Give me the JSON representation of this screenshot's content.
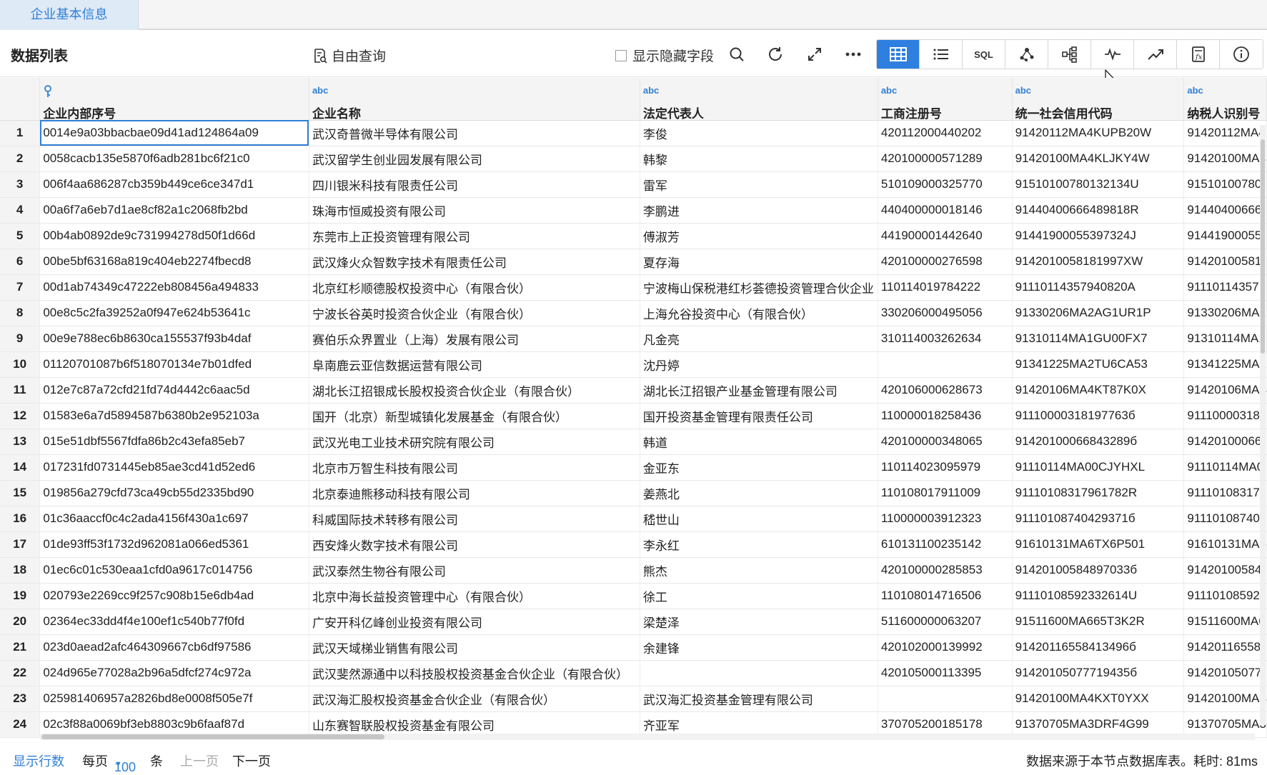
{
  "tabs": [
    {
      "label": "企业基本信息",
      "active": true
    }
  ],
  "toolbar": {
    "title": "数据列表",
    "free_query_label": "自由查询",
    "show_hidden_label": "显示隐藏字段",
    "sql_label": "SQL"
  },
  "columns": [
    {
      "type": "key",
      "label": "企业内部序号"
    },
    {
      "type": "abc",
      "label": "企业名称"
    },
    {
      "type": "abc",
      "label": "法定代表人"
    },
    {
      "type": "abc",
      "label": "工商注册号"
    },
    {
      "type": "abc",
      "label": "统一社会信用代码"
    },
    {
      "type": "abc",
      "label": "纳税人识别号"
    }
  ],
  "rows": [
    {
      "n": "1",
      "id": "0014e9a03bbacbae09d41ad124864a09",
      "name": "武汉奇普微半导体有限公司",
      "rep": "李俊",
      "reg": "420112000440202",
      "credit": "91420112MA4KUPB20W",
      "tax": "91420112MA4"
    },
    {
      "n": "2",
      "id": "0058cacb135e5870f6adb281bc6f21c0",
      "name": "武汉留学生创业园发展有限公司",
      "rep": "韩黎",
      "reg": "420100000571289",
      "credit": "91420100MA4KLJKY4W",
      "tax": "91420100MA4"
    },
    {
      "n": "3",
      "id": "006f4aa686287cb359b449ce6ce347d1",
      "name": "四川银米科技有限责任公司",
      "rep": "雷军",
      "reg": "510109000325770",
      "credit": "91510100780132134U",
      "tax": "91510100780"
    },
    {
      "n": "4",
      "id": "00a6f7a6eb7d1ae8cf82a1c2068fb2bd",
      "name": "珠海市恒威投资有限公司",
      "rep": "李鹏进",
      "reg": "440400000018146",
      "credit": "91440400666489818R",
      "tax": "91440400666"
    },
    {
      "n": "5",
      "id": "00b4ab0892de9c731994278d50f1d66d",
      "name": "东莞市上正投资管理有限公司",
      "rep": "傅淑芳",
      "reg": "441900001442640",
      "credit": "91441900055397324J",
      "tax": "91441900055"
    },
    {
      "n": "6",
      "id": "00be5bf63168a819c404eb2274fbecd8",
      "name": "武汉烽火众智数字技术有限责任公司",
      "rep": "夏存海",
      "reg": "420100000276598",
      "credit": "9142010058181997XW",
      "tax": "91420100581"
    },
    {
      "n": "7",
      "id": "00d1ab74349c47222eb808456a494833",
      "name": "北京红杉顺德股权投资中心（有限合伙）",
      "rep": "宁波梅山保税港红杉荟德投资管理合伙企业",
      "reg": "110114019784222",
      "credit": "91110114357940820A",
      "tax": "91110114357"
    },
    {
      "n": "8",
      "id": "00e8c5c2fa39252a0f947e624b53641c",
      "name": "宁波长谷英时投资合伙企业（有限合伙）",
      "rep": "上海允谷投资中心（有限合伙）",
      "reg": "330206000495056",
      "credit": "91330206MA2AG1UR1P",
      "tax": "91330206MA2"
    },
    {
      "n": "9",
      "id": "00e9e788ec6b8630ca155537f93b4daf",
      "name": "赛伯乐众界置业（上海）发展有限公司",
      "rep": "凡金亮",
      "reg": "310114003262634",
      "credit": "91310114MA1GU00FX7",
      "tax": "91310114MA1"
    },
    {
      "n": "10",
      "id": "01120701087b6f518070134e7b01dfed",
      "name": "阜南鹿云亚信数据运营有限公司",
      "rep": "沈丹婷",
      "reg": "",
      "credit": "91341225MA2TU6CA53",
      "tax": "91341225MA2"
    },
    {
      "n": "11",
      "id": "012e7c87a72cfd21fd74d4442c6aac5d",
      "name": "湖北长江招银成长股权投资合伙企业（有限合伙）",
      "rep": "湖北长江招银产业基金管理有限公司",
      "reg": "420106000628673",
      "credit": "91420106MA4KT87K0X",
      "tax": "91420106MA4"
    },
    {
      "n": "12",
      "id": "01583e6a7d5894587b6380b2e952103a",
      "name": "国开（北京）新型城镇化发展基金（有限合伙）",
      "rep": "国开投资基金管理有限责任公司",
      "reg": "110000018258436",
      "credit": "91110000318197763б",
      "tax": "91110000318"
    },
    {
      "n": "13",
      "id": "015e51dbf5567fdfa86b2c43efa85eb7",
      "name": "武汉光电工业技术研究院有限公司",
      "rep": "韩道",
      "reg": "420100000348065",
      "credit": "91420100066843289б",
      "tax": "91420100066"
    },
    {
      "n": "14",
      "id": "017231fd0731445eb85ae3cd41d52ed6",
      "name": "北京市万智生科技有限公司",
      "rep": "金亚东",
      "reg": "110114023095979",
      "credit": "91110114MA00CJYHXL",
      "tax": "91110114MA0"
    },
    {
      "n": "15",
      "id": "019856a279cfd73ca49cb55d2335bd90",
      "name": "北京泰迪熊移动科技有限公司",
      "rep": "姜燕北",
      "reg": "110108017911009",
      "credit": "91110108317961782R",
      "tax": "91110108317"
    },
    {
      "n": "16",
      "id": "01c36aaccf0c4c2ada4156f430a1c697",
      "name": "科威国际技术转移有限公司",
      "rep": "嵇世山",
      "reg": "110000003912323",
      "credit": "91110108740429371б",
      "tax": "91110108740"
    },
    {
      "n": "17",
      "id": "01de93ff53f1732d962081a066ed5361",
      "name": "西安烽火数字技术有限公司",
      "rep": "李永红",
      "reg": "610131100235142",
      "credit": "91610131MA6TX6P501",
      "tax": "91610131MA6"
    },
    {
      "n": "18",
      "id": "01ec6c01c530eaa1cfd0a9617c014756",
      "name": "武汉泰然生物谷有限公司",
      "rep": "熊杰",
      "reg": "420100000285853",
      "credit": "91420100584897033б",
      "tax": "91420100584"
    },
    {
      "n": "19",
      "id": "020793e2269cc9f257c908b15e6db4ad",
      "name": "北京中海长益投资管理中心（有限合伙）",
      "rep": "徐工",
      "reg": "110108014716506",
      "credit": "91110108592332614U",
      "tax": "91110108592"
    },
    {
      "n": "20",
      "id": "02364ec33dd4f4e100ef1c540b77f0fd",
      "name": "广安开科亿峰创业投资有限公司",
      "rep": "梁楚泽",
      "reg": "511600000063207",
      "credit": "91511600MA665T3K2R",
      "tax": "91511600MA6"
    },
    {
      "n": "21",
      "id": "023d0aead2afc464309667cb6df97586",
      "name": "武汉天域梯业销售有限公司",
      "rep": "余建锋",
      "reg": "420102000139992",
      "credit": "91420116558413496б",
      "tax": "91420116558"
    },
    {
      "n": "22",
      "id": "024d965e77028a2b96a5dfcf274c972a",
      "name": "武汉斐然源通中以科技股权投资基金合伙企业（有限合伙）",
      "rep": "",
      "reg": "420105000113395",
      "credit": "91420105077719435б",
      "tax": "91420105077"
    },
    {
      "n": "23",
      "id": "025981406957a2826bd8e0008f505e7f",
      "name": "武汉海汇股权投资基金合伙企业（有限合伙）",
      "rep": "武汉海汇投资基金管理有限公司",
      "reg": "",
      "credit": "91420100MA4KXT0YXX",
      "tax": "91420100MA4"
    },
    {
      "n": "24",
      "id": "02c3f88a0069bf3eb8803c9b6faaf87d",
      "name": "山东赛智联股权投资基金有限公司",
      "rep": "齐亚军",
      "reg": "370705200185178",
      "credit": "91370705MA3DRF4G99",
      "tax": "91370705MA3"
    }
  ],
  "footer": {
    "show_rows": "显示行数",
    "per_page": "每页",
    "page_size": "100",
    "unit": "条",
    "prev": "上一页",
    "next": "下一页",
    "status": "数据来源于本节点数据库表。耗时: 81ms"
  }
}
